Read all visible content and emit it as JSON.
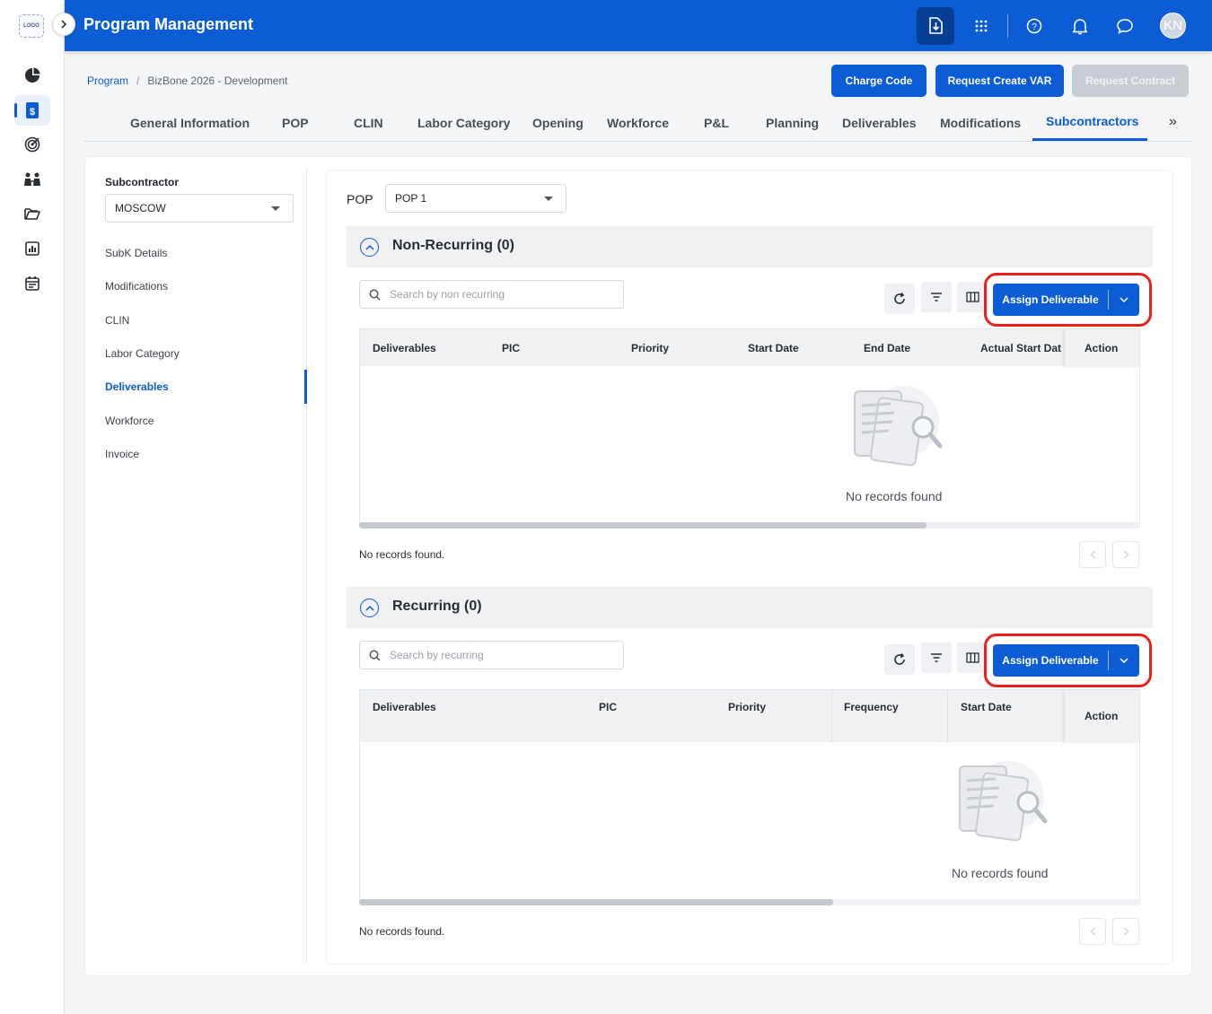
{
  "brand": {
    "logo_text": "LOGO",
    "accent": "#0b5cd5"
  },
  "header": {
    "title": "Program Management",
    "avatar_initials": "KN"
  },
  "breadcrumb": {
    "root": "Program",
    "separator": "/",
    "current": "BizBone 2026 - Development"
  },
  "actions": {
    "charge_code": "Charge Code",
    "request_create_var": "Request Create VAR",
    "request_contract": "Request Contract"
  },
  "tabs": [
    "General Information",
    "POP",
    "CLIN",
    "Labor Category",
    "Opening",
    "Workforce",
    "P&L",
    "Planning",
    "Deliverables",
    "Modifications",
    "Subcontractors"
  ],
  "tabs_more": "»",
  "subcontractor": {
    "label": "Subcontractor",
    "selected": "MOSCOW",
    "nav": [
      "SubK Details",
      "Modifications",
      "CLIN",
      "Labor Category",
      "Deliverables",
      "Workforce",
      "Invoice"
    ]
  },
  "pop": {
    "label": "POP",
    "selected": "POP 1"
  },
  "non_recurring": {
    "title": "Non-Recurring (0)",
    "search_placeholder": "Search by non recurring",
    "assign_label": "Assign Deliverable",
    "columns": [
      "Deliverables",
      "PIC",
      "Priority",
      "Start Date",
      "End Date",
      "Actual Start Dat"
    ],
    "action_col": "Action",
    "empty": "No records found",
    "footer": "No records found."
  },
  "recurring": {
    "title": "Recurring (0)",
    "search_placeholder": "Search by recurring",
    "assign_label": "Assign Deliverable",
    "columns": [
      "Deliverables",
      "PIC",
      "Priority",
      "Frequency",
      "Start Date"
    ],
    "action_col": "Action",
    "empty": "No records found",
    "footer": "No records found."
  }
}
